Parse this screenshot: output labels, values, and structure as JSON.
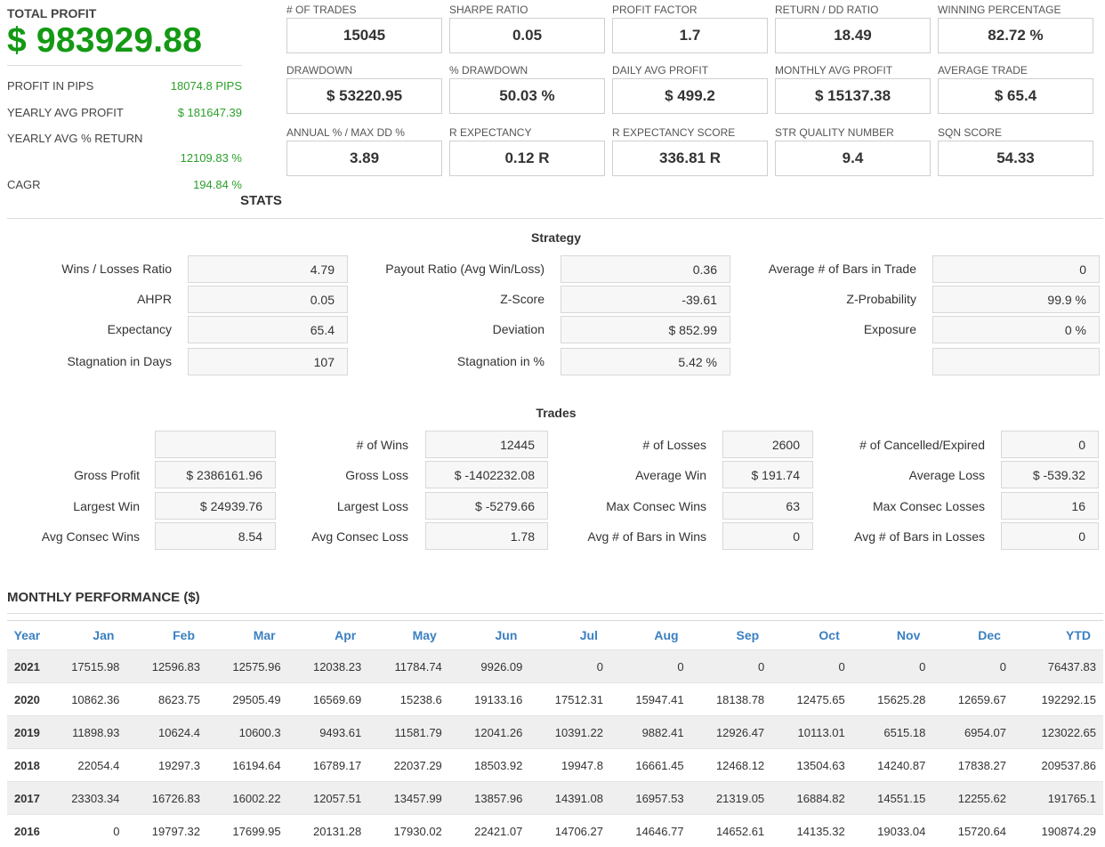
{
  "summary": {
    "total_profit_label": "TOTAL PROFIT",
    "total_profit_value": "$ 983929.88",
    "rows": [
      {
        "label": "PROFIT IN PIPS",
        "value": "18074.8 PIPS"
      },
      {
        "label": "YEARLY AVG PROFIT",
        "value": "$ 181647.39"
      },
      {
        "label": "YEARLY AVG % RETURN",
        "value": "12109.83 %"
      },
      {
        "label": "CAGR",
        "value": "194.84 %"
      }
    ]
  },
  "metrics": [
    {
      "label": "# OF TRADES",
      "value": "15045"
    },
    {
      "label": "SHARPE RATIO",
      "value": "0.05"
    },
    {
      "label": "PROFIT FACTOR",
      "value": "1.7"
    },
    {
      "label": "RETURN / DD RATIO",
      "value": "18.49"
    },
    {
      "label": "WINNING PERCENTAGE",
      "value": "82.72 %"
    },
    {
      "label": "DRAWDOWN",
      "value": "$ 53220.95"
    },
    {
      "label": "% DRAWDOWN",
      "value": "50.03 %"
    },
    {
      "label": "DAILY AVG PROFIT",
      "value": "$ 499.2"
    },
    {
      "label": "MONTHLY AVG PROFIT",
      "value": "$ 15137.38"
    },
    {
      "label": "AVERAGE TRADE",
      "value": "$ 65.4"
    },
    {
      "label": "ANNUAL % / MAX DD %",
      "value": "3.89"
    },
    {
      "label": "R EXPECTANCY",
      "value": "0.12 R"
    },
    {
      "label": "R EXPECTANCY SCORE",
      "value": "336.81 R"
    },
    {
      "label": "STR QUALITY NUMBER",
      "value": "9.4"
    },
    {
      "label": "SQN SCORE",
      "value": "54.33"
    }
  ],
  "stats_title": "STATS",
  "strategy": {
    "title": "Strategy",
    "rows": [
      [
        {
          "label": "Wins / Losses Ratio",
          "value": "4.79"
        },
        {
          "label": "Payout Ratio (Avg Win/Loss)",
          "value": "0.36"
        },
        {
          "label": "Average # of Bars in Trade",
          "value": "0"
        }
      ],
      [
        {
          "label": "AHPR",
          "value": "0.05"
        },
        {
          "label": "Z-Score",
          "value": "-39.61"
        },
        {
          "label": "Z-Probability",
          "value": "99.9 %"
        }
      ],
      [
        {
          "label": "Expectancy",
          "value": "65.4"
        },
        {
          "label": "Deviation",
          "value": "$ 852.99"
        },
        {
          "label": "Exposure",
          "value": "0 %"
        }
      ],
      [
        {
          "label": "Stagnation in Days",
          "value": "107"
        },
        {
          "label": "Stagnation in %",
          "value": "5.42 %"
        },
        {
          "label": "",
          "value": ""
        }
      ]
    ]
  },
  "trades": {
    "title": "Trades",
    "rows": [
      [
        {
          "label": "",
          "value": ""
        },
        {
          "label": "# of Wins",
          "value": "12445"
        },
        {
          "label": "# of Losses",
          "value": "2600"
        },
        {
          "label": "# of Cancelled/Expired",
          "value": "0"
        }
      ],
      [
        {
          "label": "Gross Profit",
          "value": "$ 2386161.96"
        },
        {
          "label": "Gross Loss",
          "value": "$ -1402232.08"
        },
        {
          "label": "Average Win",
          "value": "$ 191.74"
        },
        {
          "label": "Average Loss",
          "value": "$ -539.32"
        }
      ],
      [
        {
          "label": "Largest Win",
          "value": "$ 24939.76"
        },
        {
          "label": "Largest Loss",
          "value": "$ -5279.66"
        },
        {
          "label": "Max Consec Wins",
          "value": "63"
        },
        {
          "label": "Max Consec Losses",
          "value": "16"
        }
      ],
      [
        {
          "label": "Avg Consec Wins",
          "value": "8.54"
        },
        {
          "label": "Avg Consec Loss",
          "value": "1.78"
        },
        {
          "label": "Avg # of Bars in Wins",
          "value": "0"
        },
        {
          "label": "Avg # of Bars in Losses",
          "value": "0"
        }
      ]
    ]
  },
  "monthly": {
    "title": "MONTHLY PERFORMANCE ($)",
    "headers": [
      "Year",
      "Jan",
      "Feb",
      "Mar",
      "Apr",
      "May",
      "Jun",
      "Jul",
      "Aug",
      "Sep",
      "Oct",
      "Nov",
      "Dec",
      "YTD"
    ],
    "rows": [
      [
        "2021",
        "17515.98",
        "12596.83",
        "12575.96",
        "12038.23",
        "11784.74",
        "9926.09",
        "0",
        "0",
        "0",
        "0",
        "0",
        "0",
        "76437.83"
      ],
      [
        "2020",
        "10862.36",
        "8623.75",
        "29505.49",
        "16569.69",
        "15238.6",
        "19133.16",
        "17512.31",
        "15947.41",
        "18138.78",
        "12475.65",
        "15625.28",
        "12659.67",
        "192292.15"
      ],
      [
        "2019",
        "11898.93",
        "10624.4",
        "10600.3",
        "9493.61",
        "11581.79",
        "12041.26",
        "10391.22",
        "9882.41",
        "12926.47",
        "10113.01",
        "6515.18",
        "6954.07",
        "123022.65"
      ],
      [
        "2018",
        "22054.4",
        "19297.3",
        "16194.64",
        "16789.17",
        "22037.29",
        "18503.92",
        "19947.8",
        "16661.45",
        "12468.12",
        "13504.63",
        "14240.87",
        "17838.27",
        "209537.86"
      ],
      [
        "2017",
        "23303.34",
        "16726.83",
        "16002.22",
        "12057.51",
        "13457.99",
        "13857.96",
        "14391.08",
        "16957.53",
        "21319.05",
        "16884.82",
        "14551.15",
        "12255.62",
        "191765.1"
      ],
      [
        "2016",
        "0",
        "19797.32",
        "17699.95",
        "20131.28",
        "17930.02",
        "22421.07",
        "14706.27",
        "14646.77",
        "14652.61",
        "14135.32",
        "19033.04",
        "15720.64",
        "190874.29"
      ]
    ]
  }
}
